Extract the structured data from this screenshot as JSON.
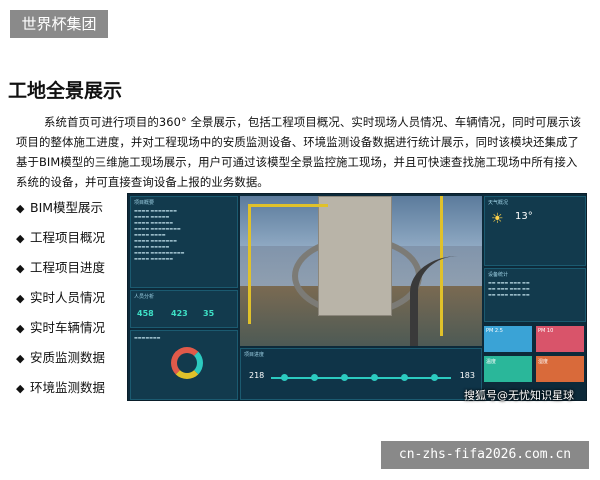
{
  "brand": {
    "label": "世界杯集团"
  },
  "section": {
    "title": "工地全景展示",
    "description": "系统首页可进行项目的360° 全景展示，包括工程项目概况、实时现场人员情况、车辆情况，同时可展示该项目的整体施工进度，并对工程现场中的安质监测设备、环境监测设备数据进行统计展示，同时该模块还集成了基于BIM模型的三维施工现场展示，用户可通过该模型全景监控施工现场，并且可快速查找施工现场中所有接入系统的设备，并可直接查询设备上报的业务数据。"
  },
  "features": [
    {
      "label": "BIM模型展示"
    },
    {
      "label": "工程项目概况"
    },
    {
      "label": "工程项目进度"
    },
    {
      "label": "实时人员情况"
    },
    {
      "label": "实时车辆情况"
    },
    {
      "label": "安质监测数据"
    },
    {
      "label": "环境监测数据"
    }
  ],
  "dashboard": {
    "panel_project": "项目概要",
    "panel_people": "人员分析",
    "people_numbers": [
      "458",
      "423",
      "35"
    ],
    "panel_progress": "项目进度",
    "timeline_left": "218",
    "timeline_right": "183",
    "panel_weather": "天气概况",
    "temperature": "13°",
    "panel_devices": "设备统计",
    "tiles": [
      {
        "label": "PM 2.5",
        "color": "#3aa3d6"
      },
      {
        "label": "PM 10",
        "color": "#d9546a"
      },
      {
        "label": "温度",
        "color": "#2ab79a"
      },
      {
        "label": "湿度",
        "color": "#d96a3a"
      }
    ]
  },
  "watermarks": {
    "sohu": "搜狐号@无忧知识星球",
    "site": "cn-zhs-fifa2026.com.cn"
  }
}
